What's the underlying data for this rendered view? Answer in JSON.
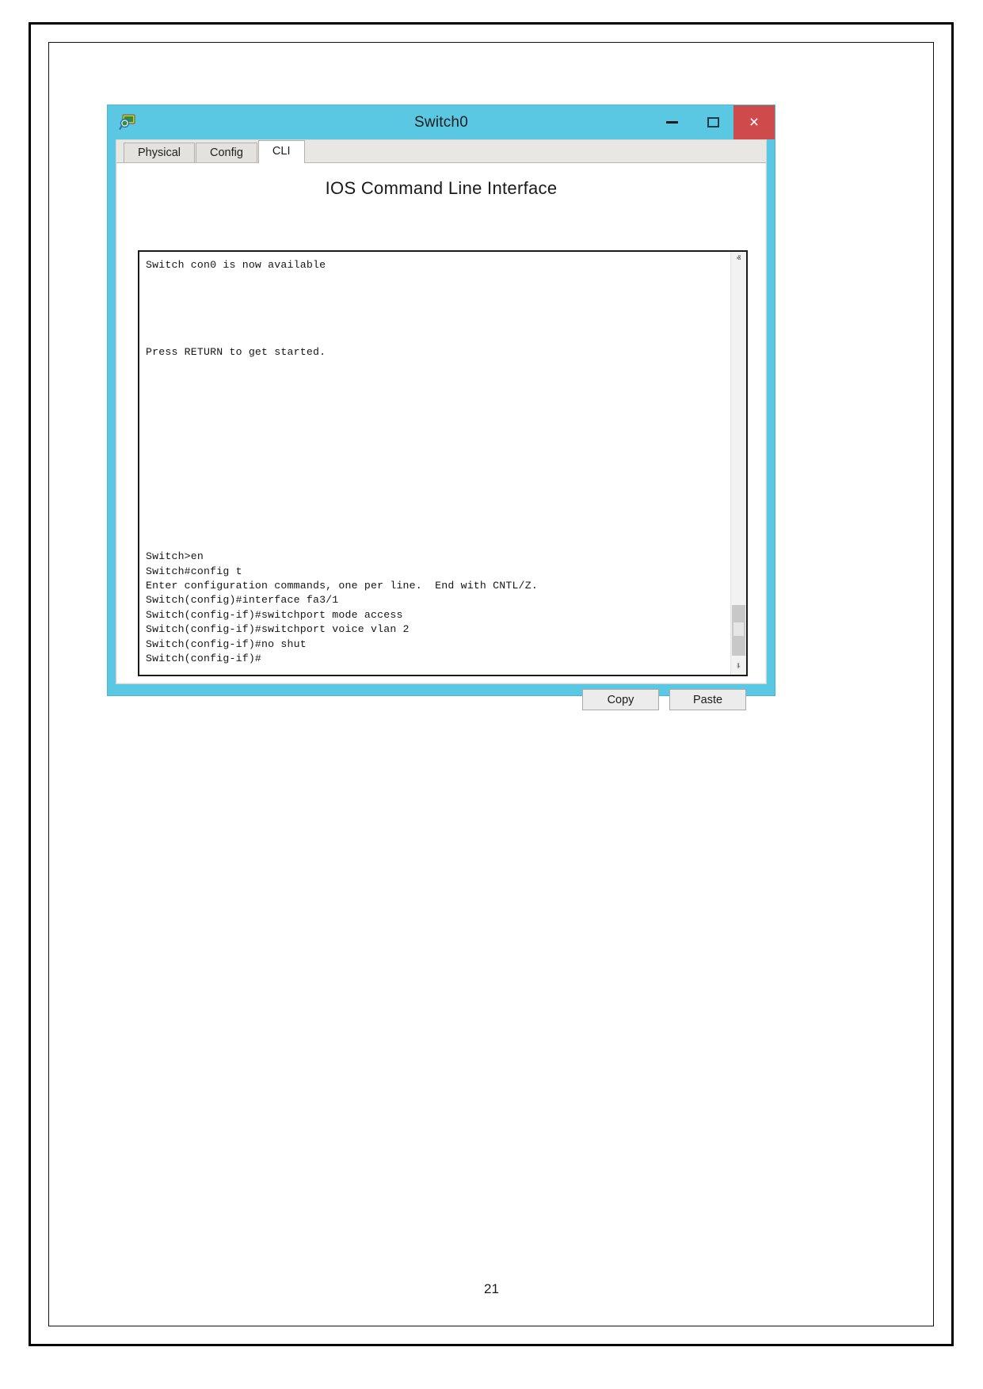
{
  "document": {
    "page_number": "21"
  },
  "window": {
    "title": "Switch0",
    "icon": "packet-tracer-device-icon",
    "controls": {
      "minimize": "–",
      "maximize": "□",
      "close": "×"
    },
    "colors": {
      "frame": "#5bc8e3",
      "close_button": "#cf4a4a",
      "panel": "#f1f0ee"
    }
  },
  "tabs": [
    {
      "label": "Physical",
      "active": false
    },
    {
      "label": "Config",
      "active": false
    },
    {
      "label": "CLI",
      "active": true
    }
  ],
  "cli": {
    "heading": "IOS Command Line Interface",
    "terminal_output": "Switch con0 is now available\n\n\n\n\n\nPress RETURN to get started.\n\n\n\n\n\n\n\n\n\n\n\n\n\nSwitch>en\nSwitch#config t\nEnter configuration commands, one per line.  End with CNTL/Z.\nSwitch(config)#interface fa3/1\nSwitch(config-if)#switchport mode access\nSwitch(config-if)#switchport voice vlan 2\nSwitch(config-if)#no shut\nSwitch(config-if)#",
    "scrollbar": {
      "up_arrow": "ⱏ",
      "down_arrow": "ⱛ"
    },
    "buttons": {
      "copy": "Copy",
      "paste": "Paste"
    }
  }
}
